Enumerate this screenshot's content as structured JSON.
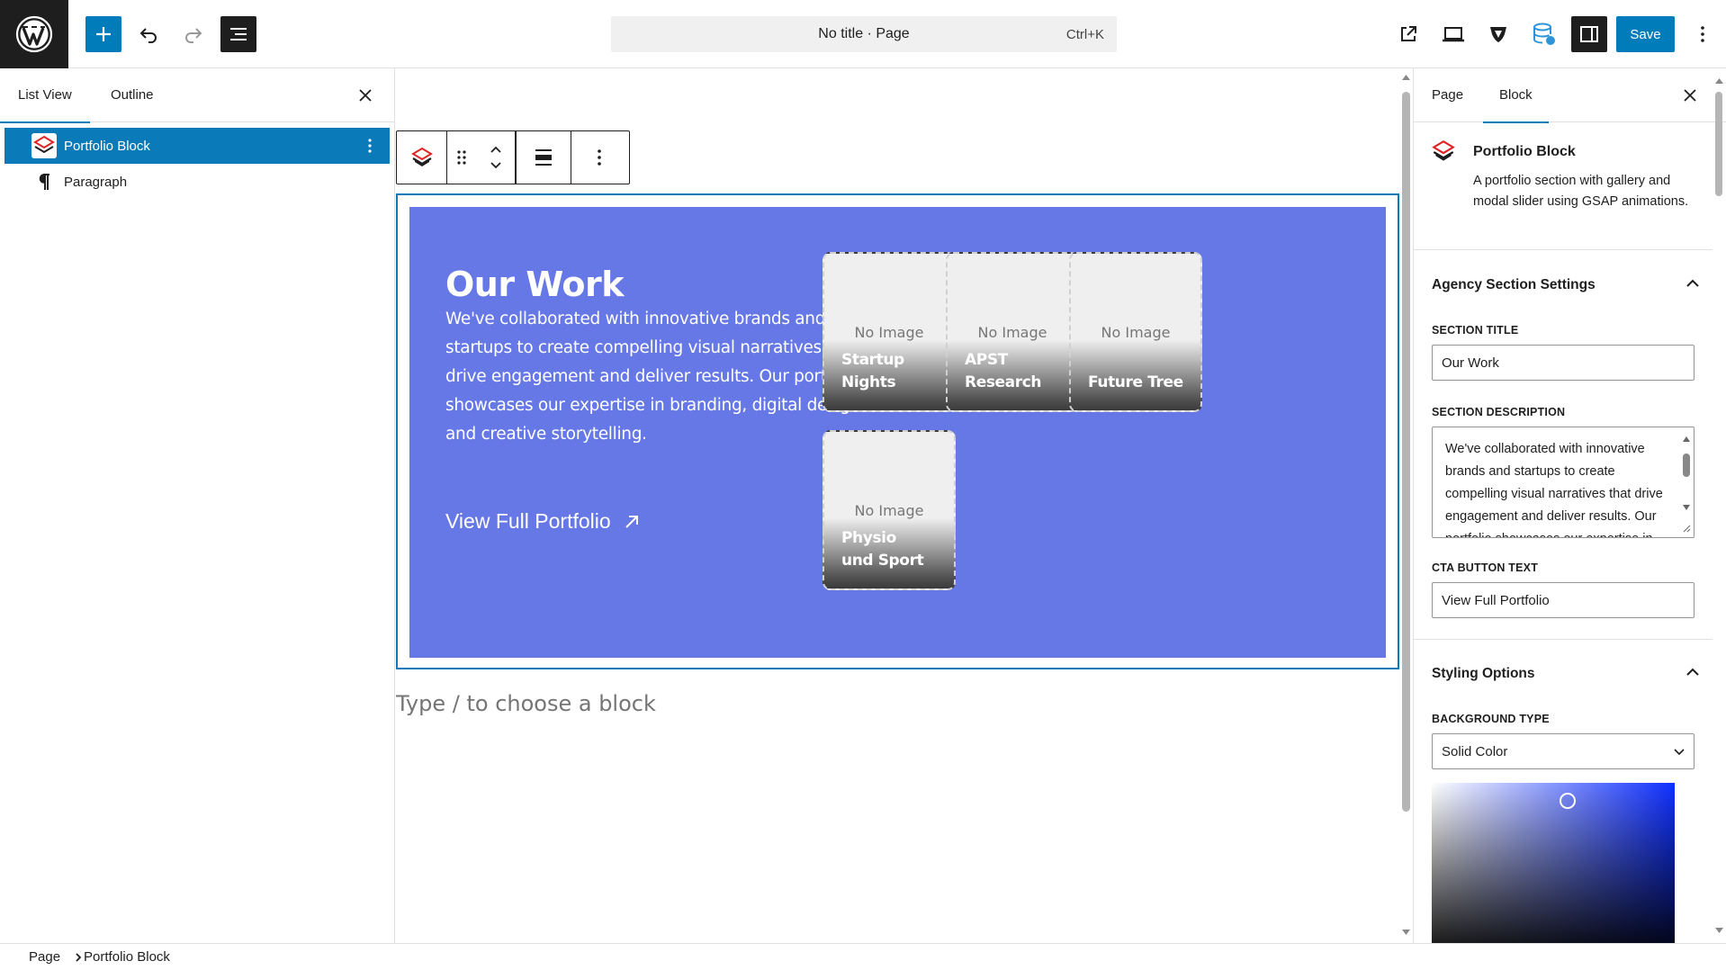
{
  "topbar": {
    "command_bar": {
      "title": "No title · Page",
      "shortcut": "Ctrl+K"
    },
    "save_label": "Save",
    "colors": {
      "accent": "#007cba",
      "dark": "#1e1e1e"
    }
  },
  "left_panel": {
    "tabs": [
      "List View",
      "Outline"
    ],
    "items": [
      {
        "label": "Portfolio Block",
        "selected": true
      },
      {
        "label": "Paragraph",
        "selected": false
      }
    ]
  },
  "canvas": {
    "portfolio": {
      "title": "Our Work",
      "description": "We've collaborated with innovative brands and startups to create compelling visual narratives that drive engagement and deliver results. Our portfolio showcases our expertise in branding, digital design, and creative storytelling.",
      "cta": "View Full Portfolio",
      "background": "#6677e6",
      "cards": [
        {
          "placeholder": "No Image",
          "name": "Startup Nights"
        },
        {
          "placeholder": "No Image",
          "name": "APST Research"
        },
        {
          "placeholder": "No Image",
          "name": "Future Tree"
        },
        {
          "placeholder": "No Image",
          "name": "Physio und Sport"
        }
      ]
    },
    "type_hint": "Type / to choose a block"
  },
  "right_panel": {
    "tabs": [
      "Page",
      "Block"
    ],
    "block": {
      "title": "Portfolio Block",
      "description": "A portfolio section with gallery and modal slider using GSAP animations."
    },
    "agency_section": {
      "heading": "Agency Section Settings",
      "section_title_label": "SECTION TITLE",
      "section_title_value": "Our Work",
      "section_description_label": "SECTION DESCRIPTION",
      "section_description_value": "We've collaborated with innovative brands and startups to create compelling visual narratives that drive engagement and deliver results. Our portfolio showcases our expertise in branding, digital design, and creative storytelling.",
      "cta_label": "CTA BUTTON TEXT",
      "cta_value": "View Full Portfolio"
    },
    "styling": {
      "heading": "Styling Options",
      "background_type_label": "BACKGROUND TYPE",
      "background_type_value": "Solid Color"
    }
  },
  "footer": {
    "breadcrumb": [
      "Page",
      "Portfolio Block"
    ]
  }
}
